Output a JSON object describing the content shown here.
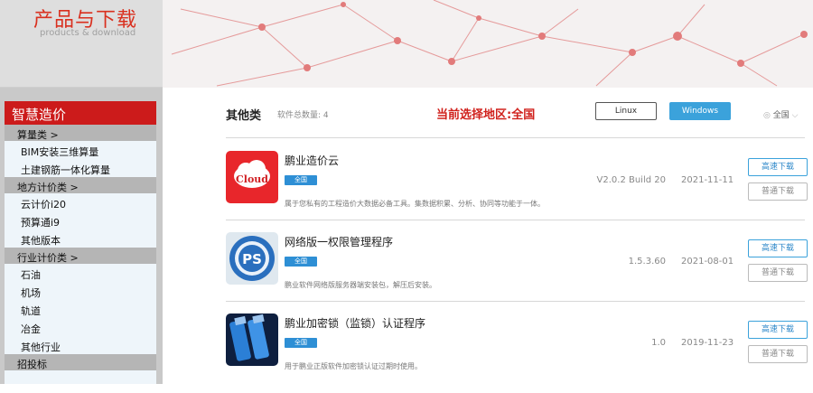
{
  "banner": {
    "title": "产品与下载",
    "subtitle": "products & download"
  },
  "sidebar": {
    "heading": "智慧造价",
    "categories": [
      {
        "label": "算量类 >",
        "items": [
          "BIM安装三维算量",
          "土建钢筋一体化算量"
        ]
      },
      {
        "label": "地方计价类 >",
        "items": [
          "云计价i20",
          "预算通i9",
          "其他版本"
        ]
      },
      {
        "label": "行业计价类 >",
        "items": [
          "石油",
          "机场",
          "轨道",
          "冶金",
          "其他行业"
        ]
      },
      {
        "label": "招投标",
        "items": []
      }
    ]
  },
  "main": {
    "section_title": "其他类",
    "count_label": "软件总数量: 4",
    "region_label": "当前选择地区:全国",
    "os_buttons": {
      "linux": "Linux",
      "windows": "Windows"
    },
    "region_select": {
      "icon": "radio-icon",
      "value": "全国"
    },
    "products": [
      {
        "name": "鹏业造价云",
        "tag": "全国",
        "description": "属于您私有的工程造价大数据必备工具。集数据积累、分析、协同等功能于一体。",
        "version": "V2.0.2 Build 20",
        "date": "2021-11-11",
        "fast_label": "高速下载",
        "normal_label": "普通下载",
        "thumb_text": "Cloud"
      },
      {
        "name": "网络版一权限管理程序",
        "tag": "全国",
        "description": "鹏业软件网络版服务器端安装包，解压后安装。",
        "version": "1.5.3.60",
        "date": "2021-08-01",
        "fast_label": "高速下载",
        "normal_label": "普通下载",
        "thumb_text": "PS"
      },
      {
        "name": "鹏业加密锁（监锁）认证程序",
        "tag": "全国",
        "description": "用于鹏业正版软件加密锁认证过期时使用。",
        "version": "1.0",
        "date": "2019-11-23",
        "fast_label": "高速下载",
        "normal_label": "普通下载",
        "thumb_text": ""
      }
    ]
  },
  "colors": {
    "accent_red": "#cc1b1b",
    "accent_blue": "#3ba2db"
  }
}
